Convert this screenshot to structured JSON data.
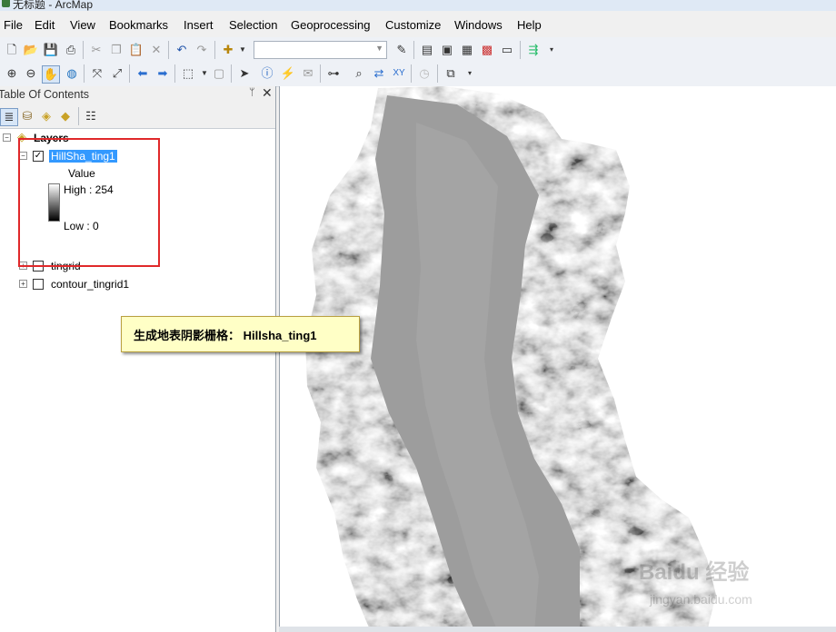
{
  "window": {
    "title": "无标题 - ArcMap"
  },
  "menu": [
    "File",
    "Edit",
    "View",
    "Bookmarks",
    "Insert",
    "Selection",
    "Geoprocessing",
    "Customize",
    "Windows",
    "Help"
  ],
  "toolbar": {
    "scale_value": ""
  },
  "toc": {
    "title": "Table Of Contents",
    "pin": "ᛘ",
    "close": "✕",
    "root": "Layers",
    "layers": [
      {
        "name": "HillSha_ting1",
        "checked": true,
        "selected": true
      },
      {
        "name": "tingrid",
        "checked": false
      },
      {
        "name": "contour_tingrid1",
        "checked": false
      }
    ],
    "legend": {
      "field": "Value",
      "high": "High : 254",
      "low": "Low : 0"
    }
  },
  "callout": {
    "text": "生成地表阴影栅格： Hillsha_ting1"
  },
  "watermark": {
    "text": "Baidu 经验",
    "url": "jingyan.baidu.com"
  },
  "colors": {
    "selection": "#3399ff",
    "highlight_box": "#e0282a",
    "callout_bg": "#ffffc6"
  }
}
